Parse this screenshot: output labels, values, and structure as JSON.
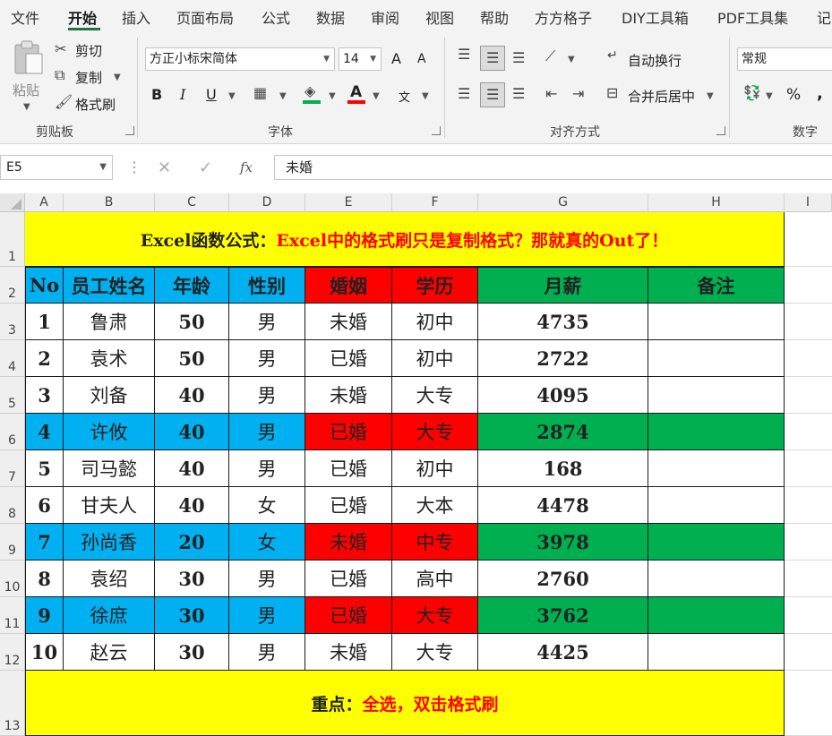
{
  "ribbon_tabs": [
    "文件",
    "开始",
    "插入",
    "页面布局",
    "公式",
    "数据",
    "审阅",
    "视图",
    "帮助",
    "方方格子",
    "DIY工具箱",
    "PDF工具集",
    "记"
  ],
  "clipboard": {
    "paste": "粘贴",
    "cut": "剪切",
    "copy": "复制",
    "format_painter": "格式刷",
    "label": "剪贴板"
  },
  "font": {
    "name": "方正小标宋简体",
    "size": "14",
    "label": "字体",
    "bold": "B",
    "italic": "I",
    "underline": "U",
    "font_color": "A",
    "grow": "A",
    "shrink": "A",
    "phonetic": "文"
  },
  "alignment": {
    "wrap": "自动换行",
    "merge": "合并后居中",
    "label": "对齐方式"
  },
  "number": {
    "format": "常规",
    "percent": "%",
    "comma": ",",
    "label": "数字"
  },
  "formula_bar": {
    "name_box": "E5",
    "fx": "fx",
    "value": "未婚"
  },
  "columns": [
    "A",
    "B",
    "C",
    "D",
    "E",
    "F",
    "G",
    "H",
    "I"
  ],
  "rows": [
    "1",
    "2",
    "3",
    "4",
    "5",
    "6",
    "7",
    "8",
    "9",
    "10",
    "11",
    "12",
    "13"
  ],
  "title": {
    "black": "Excel函数公式：",
    "red": "Excel中的格式刷只是复制格式？那就真的Out了！"
  },
  "header": [
    "No",
    "员工姓名",
    "年龄",
    "性别",
    "婚姻",
    "学历",
    "月薪",
    "备注"
  ],
  "data_rows": [
    [
      "1",
      "鲁肃",
      "50",
      "男",
      "未婚",
      "初中",
      "4735",
      ""
    ],
    [
      "2",
      "袁术",
      "50",
      "男",
      "已婚",
      "初中",
      "2722",
      ""
    ],
    [
      "3",
      "刘备",
      "40",
      "男",
      "未婚",
      "大专",
      "4095",
      ""
    ],
    [
      "4",
      "许攸",
      "40",
      "男",
      "已婚",
      "大专",
      "2874",
      ""
    ],
    [
      "5",
      "司马懿",
      "40",
      "男",
      "已婚",
      "初中",
      "168",
      ""
    ],
    [
      "6",
      "甘夫人",
      "40",
      "女",
      "已婚",
      "大本",
      "4478",
      ""
    ],
    [
      "7",
      "孙尚香",
      "20",
      "女",
      "未婚",
      "中专",
      "3978",
      ""
    ],
    [
      "8",
      "袁绍",
      "30",
      "男",
      "已婚",
      "高中",
      "2760",
      ""
    ],
    [
      "9",
      "徐庶",
      "30",
      "男",
      "已婚",
      "大专",
      "3762",
      ""
    ],
    [
      "10",
      "赵云",
      "30",
      "男",
      "未婚",
      "大专",
      "4425",
      ""
    ]
  ],
  "highlighted_rows": [
    3,
    6,
    8
  ],
  "footer": {
    "black": "重点：",
    "red": "全选，双击格式刷"
  },
  "colors": {
    "blue": "#00b0f0",
    "red": "#ff0000",
    "green": "#00b050",
    "yellow": "#ffff00",
    "excel_green": "#217346"
  }
}
